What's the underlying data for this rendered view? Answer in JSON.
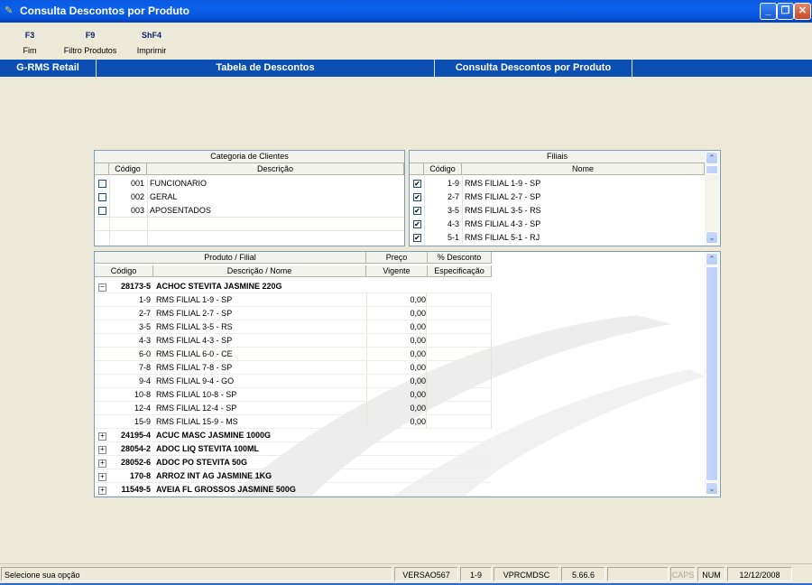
{
  "window": {
    "title": "Consulta Descontos por Produto"
  },
  "toolbar": [
    {
      "key": "F3",
      "label": "Fim"
    },
    {
      "key": "F9",
      "label": "Filtro Produtos"
    },
    {
      "key": "ShF4",
      "label": "Imprimir"
    }
  ],
  "header": {
    "left": "G-RMS Retail",
    "center": "Tabela de Descontos",
    "right": "Consulta Descontos por Produto"
  },
  "categorias": {
    "group_title": "Categoria de Clientes",
    "col_codigo": "Código",
    "col_descricao": "Descrição",
    "rows": [
      {
        "codigo": "001",
        "descricao": "FUNCIONARIO",
        "checked": false
      },
      {
        "codigo": "002",
        "descricao": "GERAL",
        "checked": false
      },
      {
        "codigo": "003",
        "descricao": "APOSENTADOS",
        "checked": false
      }
    ]
  },
  "filiais": {
    "group_title": "Filiais",
    "col_codigo": "Código",
    "col_nome": "Nome",
    "rows": [
      {
        "codigo": "1-9",
        "nome": "RMS FILIAL 1-9 - SP",
        "checked": true
      },
      {
        "codigo": "2-7",
        "nome": "RMS FILIAL 2-7 - SP",
        "checked": true
      },
      {
        "codigo": "3-5",
        "nome": "RMS FILIAL 3-5 - RS",
        "checked": true
      },
      {
        "codigo": "4-3",
        "nome": "RMS FILIAL 4-3 - SP",
        "checked": true
      },
      {
        "codigo": "5-1",
        "nome": "RMS FILIAL 5-1 - RJ",
        "checked": true
      }
    ]
  },
  "produtos": {
    "group_produto": "Produto / Filial",
    "group_preco": "Preço",
    "group_desconto": "% Desconto",
    "col_codigo": "Código",
    "col_descricao": "Descrição / Nome",
    "col_vigente": "Vigente",
    "col_especificacao": "Especificação",
    "rows": [
      {
        "type": "product",
        "expanded": true,
        "codigo": "28173-5",
        "descricao": "ACHOC STEVITA JASMINE 220G",
        "preco": ""
      },
      {
        "type": "filial",
        "codigo": "1-9",
        "descricao": "RMS FILIAL 1-9 - SP",
        "preco": "0,00"
      },
      {
        "type": "filial",
        "codigo": "2-7",
        "descricao": "RMS FILIAL 2-7 - SP",
        "preco": "0,00"
      },
      {
        "type": "filial",
        "codigo": "3-5",
        "descricao": "RMS FILIAL 3-5 - RS",
        "preco": "0,00"
      },
      {
        "type": "filial",
        "codigo": "4-3",
        "descricao": "RMS FILIAL 4-3 - SP",
        "preco": "0,00"
      },
      {
        "type": "filial",
        "codigo": "6-0",
        "descricao": "RMS FILIAL 6-0 - CE",
        "preco": "0,00"
      },
      {
        "type": "filial",
        "codigo": "7-8",
        "descricao": "RMS FILIAL 7-8 - SP",
        "preco": "0,00"
      },
      {
        "type": "filial",
        "codigo": "9-4",
        "descricao": "RMS FILIAL 9-4 - GO",
        "preco": "0,00"
      },
      {
        "type": "filial",
        "codigo": "10-8",
        "descricao": "RMS FILIAL 10-8 - SP",
        "preco": "0,00"
      },
      {
        "type": "filial",
        "codigo": "12-4",
        "descricao": "RMS FILIAL 12-4 - SP",
        "preco": "0,00"
      },
      {
        "type": "filial",
        "codigo": "15-9",
        "descricao": "RMS FILIAL 15-9 - MS",
        "preco": "0,00"
      },
      {
        "type": "product",
        "expanded": false,
        "codigo": "24195-4",
        "descricao": "ACUC MASC JASMINE 1000G",
        "preco": ""
      },
      {
        "type": "product",
        "expanded": false,
        "codigo": "28054-2",
        "descricao": "ADOC LIQ STEVITA 100ML",
        "preco": ""
      },
      {
        "type": "product",
        "expanded": false,
        "codigo": "28052-6",
        "descricao": "ADOC PO STEVITA 50G",
        "preco": ""
      },
      {
        "type": "product",
        "expanded": false,
        "codigo": "170-8",
        "descricao": "ARROZ INT AG JASMINE 1KG",
        "preco": ""
      },
      {
        "type": "product",
        "expanded": false,
        "codigo": "11549-5",
        "descricao": "AVEIA FL GROSSOS JASMINE 500G",
        "preco": ""
      }
    ]
  },
  "statusbar": {
    "message": "Selecione sua opção",
    "version": "VERSAO567",
    "filial": "1-9",
    "program": "VPRCMDSC",
    "build": "5.66.6",
    "extra": "",
    "caps": "CAPS",
    "num": "NUM",
    "date": "12/12/2008"
  },
  "colors": {
    "header_blue": "#0b4fb5",
    "titlebar_blue": "#0a5ae0",
    "status_line": "#3169c6"
  }
}
